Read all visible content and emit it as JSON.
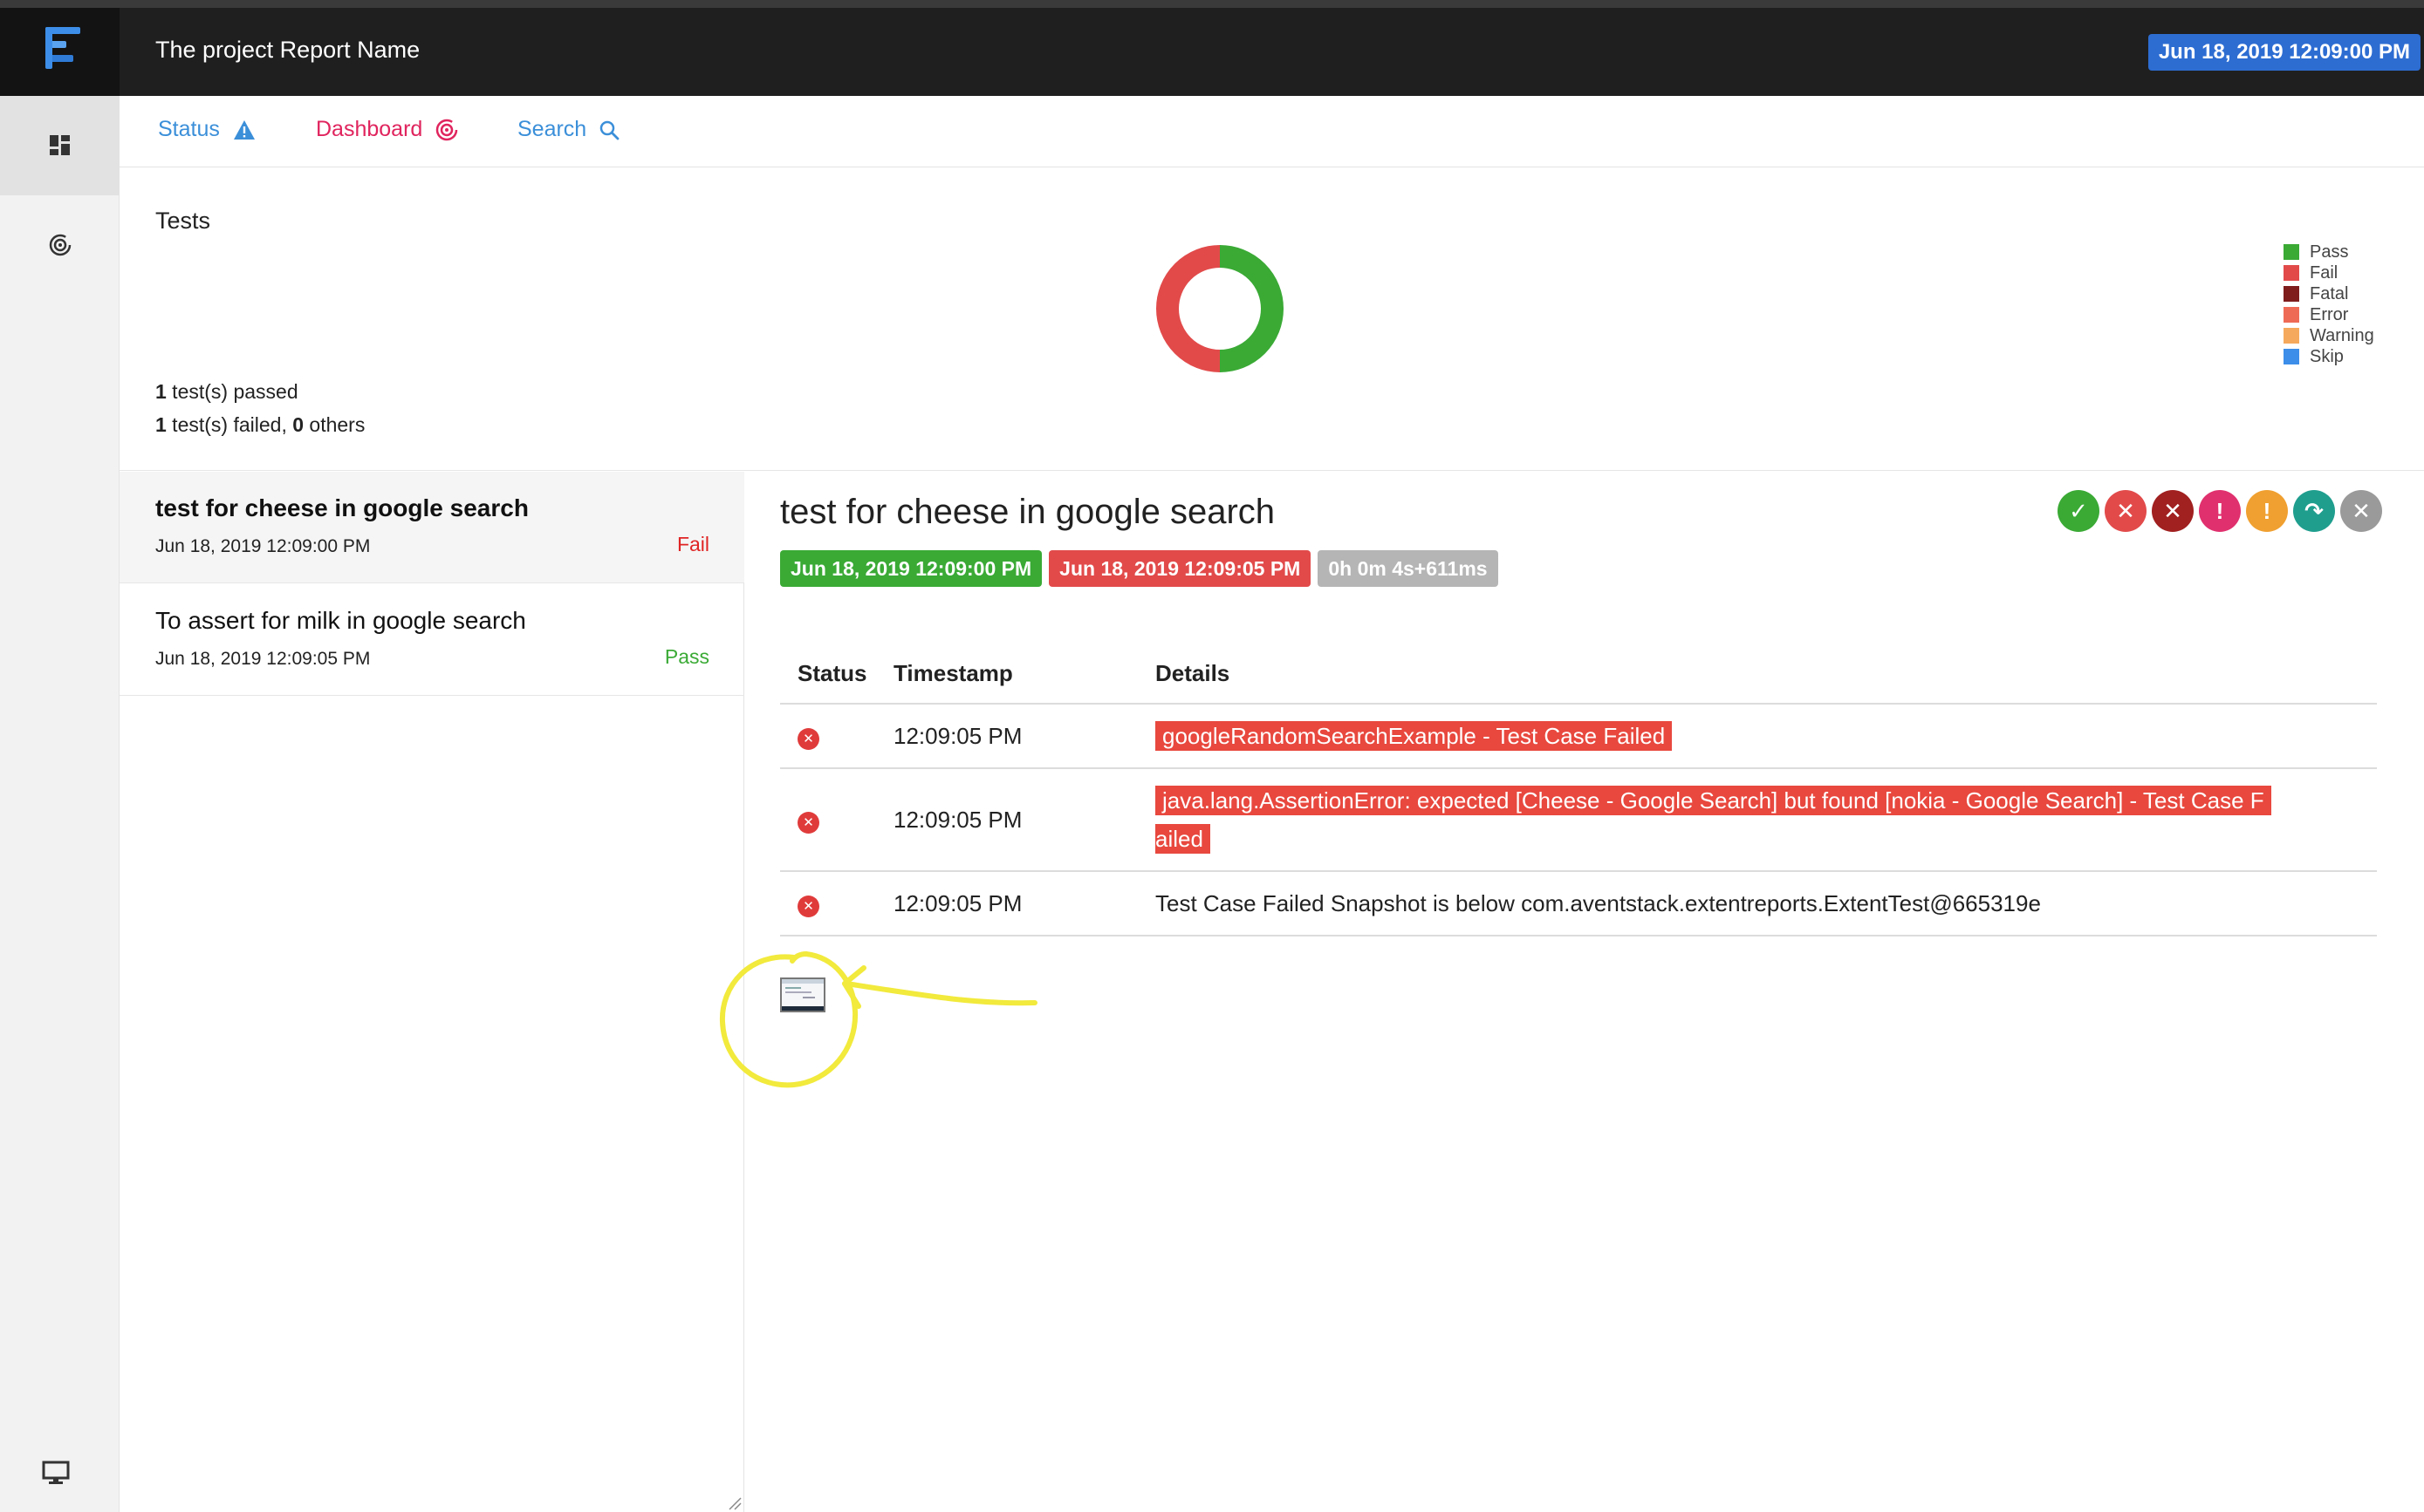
{
  "header": {
    "title": "The project Report Name",
    "date": "Jun 18, 2019 12:09:00 PM"
  },
  "rail": {
    "items": [
      "dashboard-grid-icon",
      "target-icon",
      "monitor-icon"
    ]
  },
  "nav": {
    "tabs": [
      {
        "label": "Status",
        "icon": "warning-icon"
      },
      {
        "label": "Dashboard",
        "icon": "target-icon"
      },
      {
        "label": "Search",
        "icon": "search-icon"
      }
    ]
  },
  "overview": {
    "heading": "Tests",
    "passed_count": "1",
    "passed_text": " test(s) passed",
    "failed_count": "1",
    "failed_text": " test(s) failed, ",
    "others_count": "0",
    "others_text": " others"
  },
  "chart_data": {
    "type": "pie",
    "categories": [
      "Pass",
      "Fail",
      "Fatal",
      "Error",
      "Warning",
      "Skip"
    ],
    "values": [
      1,
      1,
      0,
      0,
      0,
      0
    ],
    "colors": [
      "#3aaa35",
      "#e24a4a",
      "#7f1d1d",
      "#ef6a55",
      "#f5a95c",
      "#3d8ee8"
    ],
    "donut": true
  },
  "legend": {
    "items": [
      {
        "label": "Pass",
        "color": "#3aaa35"
      },
      {
        "label": "Fail",
        "color": "#e24a4a"
      },
      {
        "label": "Fatal",
        "color": "#7f1d1d"
      },
      {
        "label": "Error",
        "color": "#ef6a55"
      },
      {
        "label": "Warning",
        "color": "#f5a95c"
      },
      {
        "label": "Skip",
        "color": "#3d8ee8"
      }
    ]
  },
  "tests": [
    {
      "name": "test for cheese in google search",
      "time": "Jun 18, 2019 12:09:00 PM",
      "status": "Fail",
      "status_color": "#e02424"
    },
    {
      "name": "To assert for milk in google search",
      "time": "Jun 18, 2019 12:09:05 PM",
      "status": "Pass",
      "status_color": "#3aaa35"
    }
  ],
  "detail": {
    "title": "test for cheese in google search",
    "start": "Jun 18, 2019 12:09:00 PM",
    "end": "Jun 18, 2019 12:09:05 PM",
    "duration": "0h 0m 4s+611ms",
    "filters": [
      {
        "name": "pass-filter-icon",
        "color": "#3aaa35",
        "glyph": "✓"
      },
      {
        "name": "fail-filter-icon",
        "color": "#e24a4a",
        "glyph": "✕"
      },
      {
        "name": "fatal-filter-icon",
        "color": "#a12020",
        "glyph": "✕"
      },
      {
        "name": "error-filter-icon",
        "color": "#e0306e",
        "glyph": "!"
      },
      {
        "name": "warning-filter-icon",
        "color": "#f0a030",
        "glyph": "!"
      },
      {
        "name": "skip-filter-icon",
        "color": "#1f9e8e",
        "glyph": "↷"
      },
      {
        "name": "clear-filter-icon",
        "color": "#9a9a9a",
        "glyph": "✕"
      }
    ],
    "columns": {
      "status": "Status",
      "timestamp": "Timestamp",
      "details": "Details"
    },
    "logs": [
      {
        "time": "12:09:05 PM",
        "details": "googleRandomSearchExample - Test Case Failed",
        "highlight": true
      },
      {
        "time": "12:09:05 PM",
        "details_line1": "java.lang.AssertionError: expected [Cheese - Google Search] but found [nokia - Google Search] - Test Case F",
        "details_line2": "ailed",
        "highlight": true
      },
      {
        "time": "12:09:05 PM",
        "details": "Test Case Failed Snapshot is below com.aventstack.extentreports.ExtentTest@665319e",
        "highlight": false
      }
    ]
  }
}
